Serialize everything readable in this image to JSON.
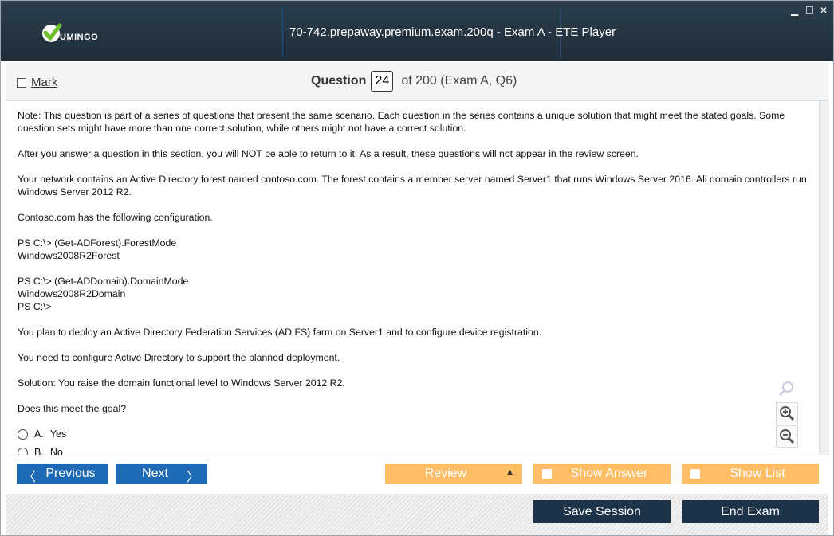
{
  "window": {
    "brand": "UMINGO",
    "title": "70-742.prepaway.premium.exam.200q - Exam A - ETE Player",
    "controls": {
      "minimize": "▁",
      "maximize": "☐",
      "close": "✕"
    }
  },
  "header": {
    "mark_label": "Mark",
    "question_label": "Question",
    "question_number": "24",
    "question_of": "of 200 (Exam A, Q6)"
  },
  "question": {
    "paragraphs": [
      "Note: This question is part of a series of questions that present the same scenario. Each question in the series contains a unique solution that might meet the stated goals. Some question sets might have more than one correct solution, while others might not have a correct solution.",
      "After you answer a question in this section, you will NOT be able to return to it. As a result, these questions will not appear in the review screen.",
      "Your network contains an Active Directory forest named contoso.com. The forest contains a member server named Server1 that runs Windows Server 2016. All domain controllers run Windows Server 2012 R2.",
      "Contoso.com has the following configuration."
    ],
    "code1": [
      "PS C:\\> (Get-ADForest).ForestMode",
      "Windows2008R2Forest"
    ],
    "code2": [
      "PS C:\\> (Get-ADDomain).DomainMode",
      "Windows2008R2Domain",
      "PS C:\\>"
    ],
    "paragraphs2": [
      "You plan to deploy an Active Directory Federation Services (AD FS) farm on Server1 and to configure device registration.",
      "You need to configure Active Directory to support the planned deployment.",
      "Solution: You raise the domain functional level to Windows Server 2012 R2.",
      "Does this meet the goal?"
    ],
    "options": [
      {
        "letter": "A.",
        "text": "Yes"
      },
      {
        "letter": "B.",
        "text": "No"
      }
    ]
  },
  "zoom": {
    "search": "search-zoom-icon",
    "in": "zoom-in-icon",
    "out": "zoom-out-icon"
  },
  "nav": {
    "previous": "Previous",
    "next": "Next",
    "review": "Review",
    "show_answer": "Show Answer",
    "show_list": "Show List",
    "save_session": "Save Session",
    "end_exam": "End Exam"
  },
  "colors": {
    "accent_blue": "#1f6ab4",
    "orange": "#ffbd66",
    "dark": "#1d3349",
    "titlebar": "#243441"
  }
}
